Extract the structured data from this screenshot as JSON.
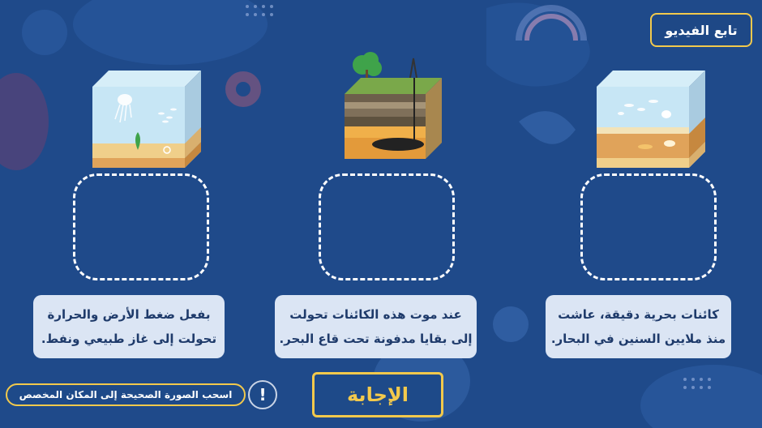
{
  "header": {
    "follow_video_label": "تابع الفيديو"
  },
  "cards": [
    {
      "line1": "كائنات بحرية دقيقة، عاشت",
      "line2": "منذ ملايين السنين في البحار."
    },
    {
      "line1": "عند موت هذه الكائنات تحولت",
      "line2": "إلى بقايا مدفونة تحت قاع البحر."
    },
    {
      "line1": "بفعل ضغط الأرض والحرارة",
      "line2": "تحولت إلى غاز طبيعي ونفط."
    }
  ],
  "answer_button_label": "الإجابة",
  "hint": {
    "text": "اسحب الصورة الصحيحة إلى المكان المخصص",
    "icon_label": "!"
  },
  "icons": {
    "cube_right": "sea-tank-sediment-icon",
    "cube_middle": "oil-rig-soil-layers-icon",
    "cube_left": "sea-tank-jellyfish-icon"
  },
  "colors": {
    "background": "#1f4a8a",
    "accent": "#f2c94c",
    "card": "#dbe5f4",
    "card_text": "#1f3b6b"
  }
}
